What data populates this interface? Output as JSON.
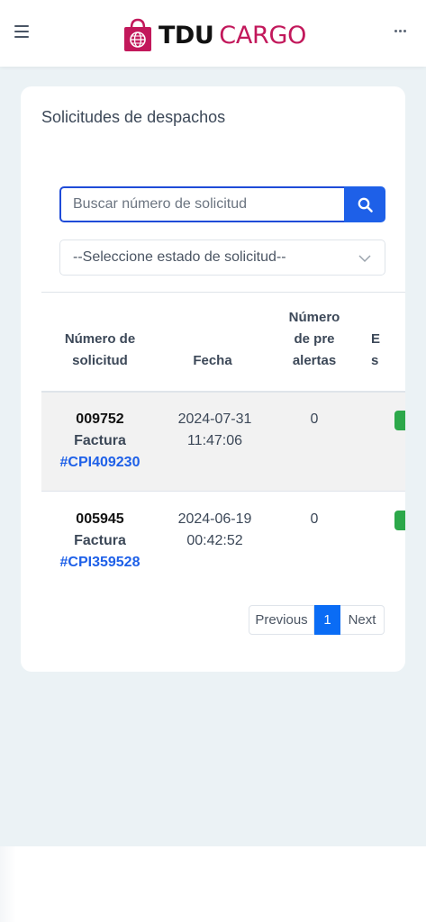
{
  "header": {
    "brand_tdu": "TDU",
    "brand_cargo": "CARGO",
    "brand_color": "#c2185b",
    "menu_icon": "hamburger-icon",
    "more_icon": "ellipsis-icon"
  },
  "card": {
    "title": "Solicitudes de despachos"
  },
  "search": {
    "placeholder": "Buscar número de solicitud",
    "value": "",
    "button_icon": "search-icon"
  },
  "status_select": {
    "selected": "--Seleccione estado de solicitud--"
  },
  "table": {
    "headers": {
      "numero_l1": "Número de",
      "numero_l2": "solicitud",
      "fecha": "Fecha",
      "pre_l1": "Número",
      "pre_l2": "de pre",
      "pre_l3": "alertas",
      "estado_l1": "E",
      "estado_l2": "s"
    },
    "rows": [
      {
        "code": "009752",
        "label": "Factura",
        "invoice": "#CPI409230",
        "date": "2024-07-31",
        "time": "11:47:06",
        "pre_alerts": "0",
        "status_color": "#2ca84a"
      },
      {
        "code": "005945",
        "label": "Factura",
        "invoice": "#CPI359528",
        "date": "2024-06-19",
        "time": "00:42:52",
        "pre_alerts": "0",
        "status_color": "#2ca84a"
      }
    ]
  },
  "pagination": {
    "previous": "Previous",
    "current": "1",
    "next": "Next"
  }
}
